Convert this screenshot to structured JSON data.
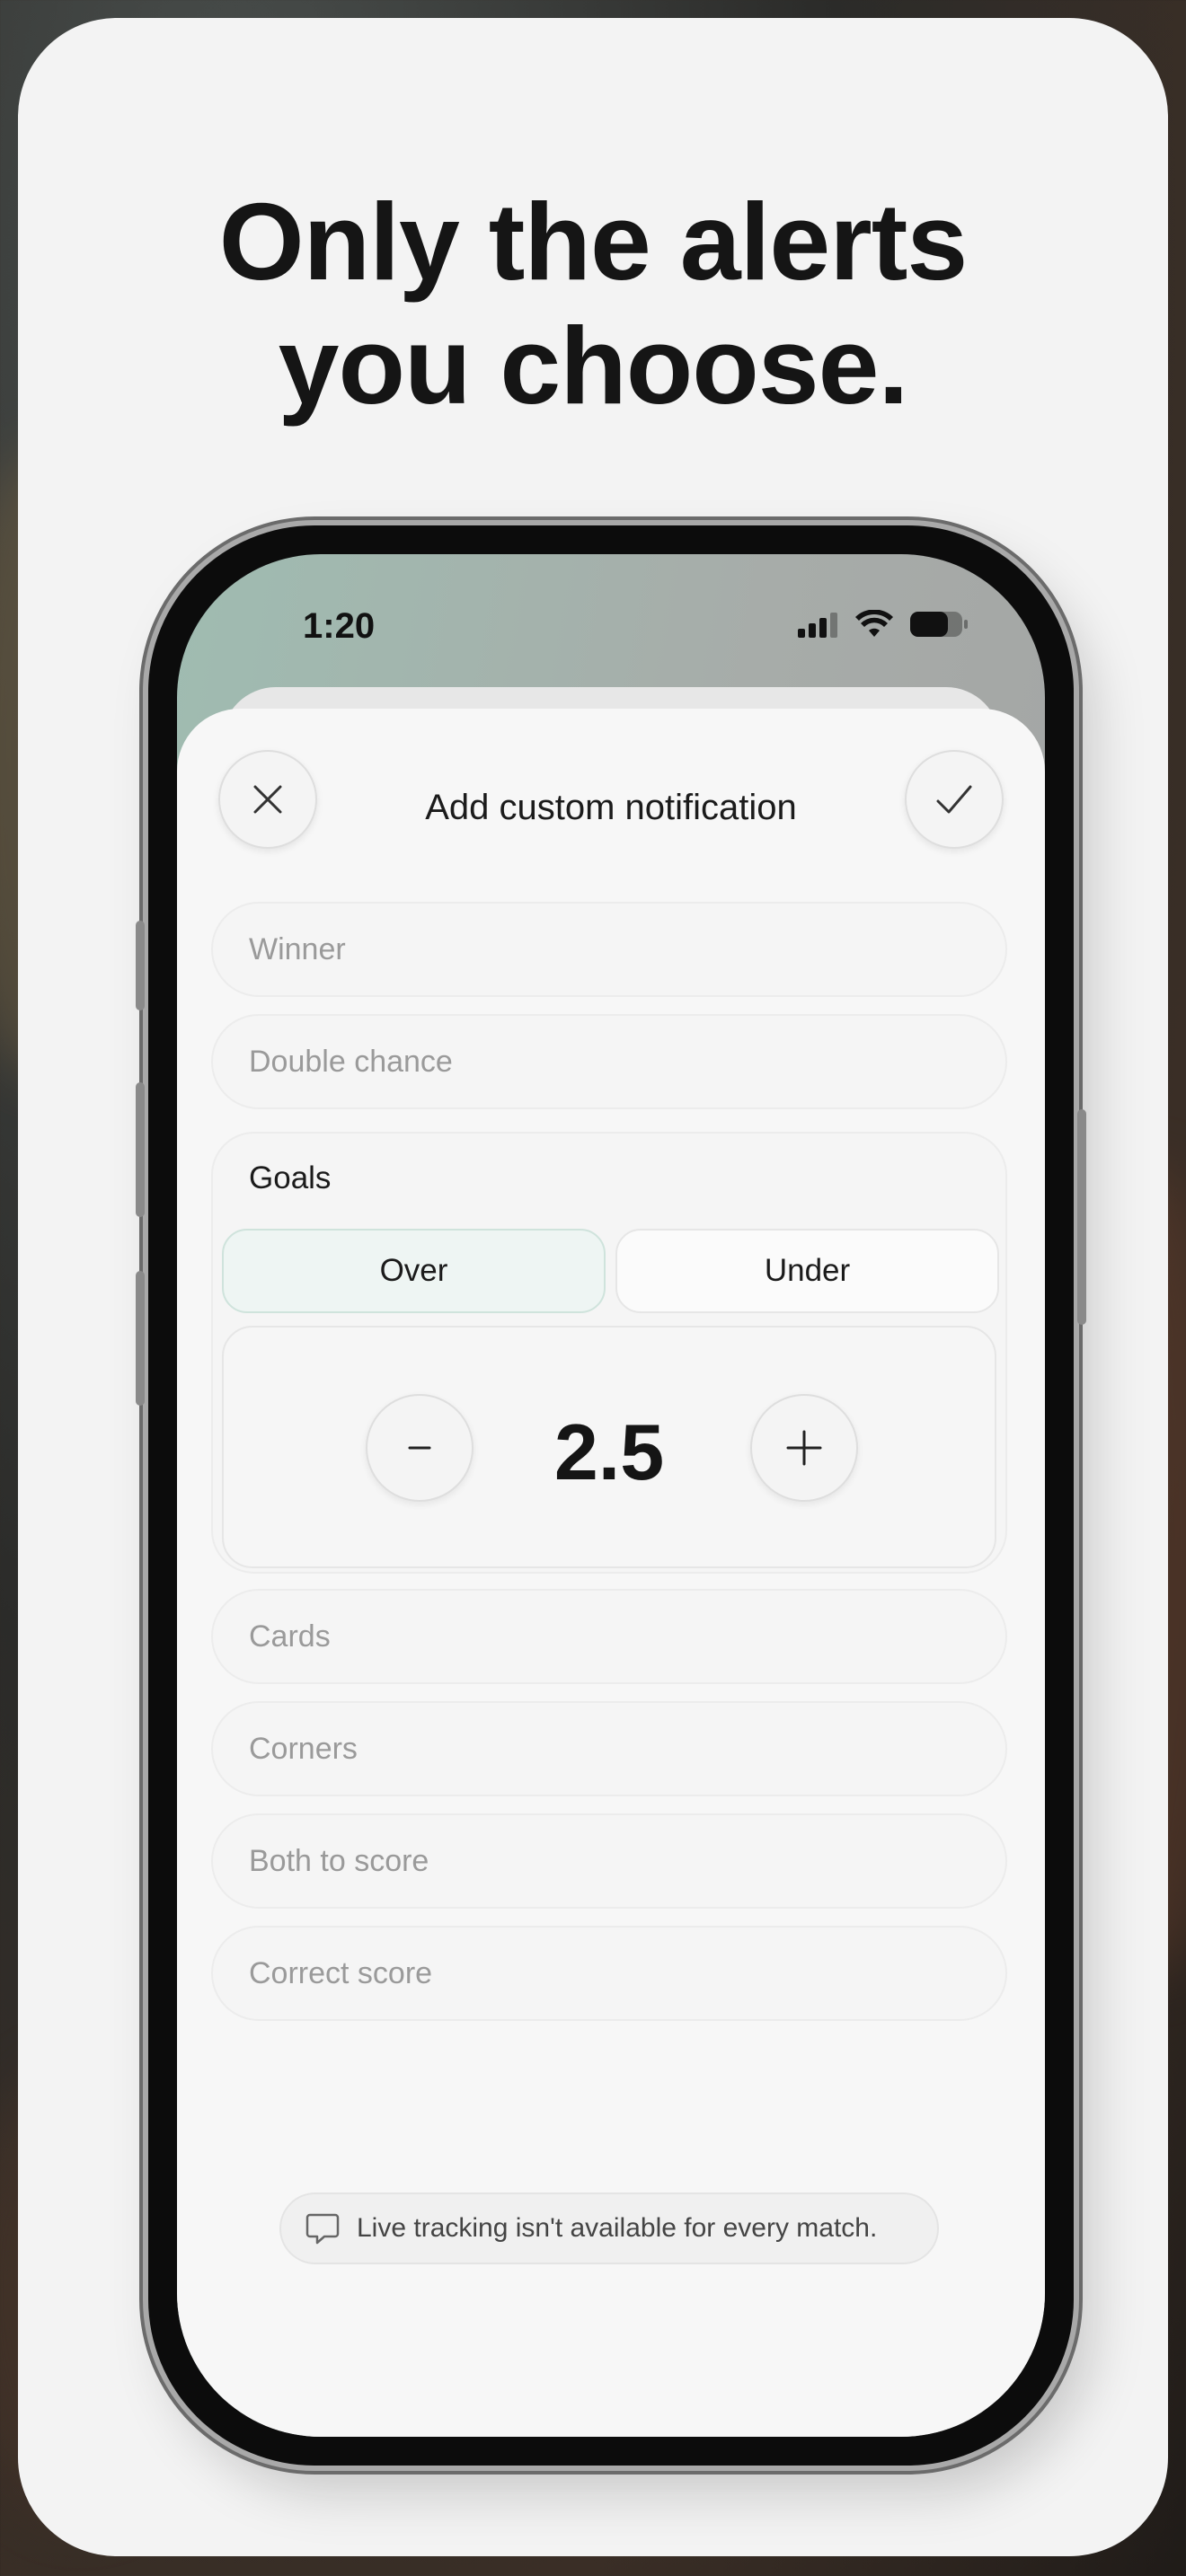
{
  "headline": {
    "line1": "Only the alerts",
    "line2": "you choose."
  },
  "status_bar": {
    "time": "1:20",
    "icons": [
      "cellular-signal-icon",
      "wifi-icon",
      "battery-icon"
    ]
  },
  "sheet": {
    "title": "Add custom notification",
    "close_icon": "close-icon",
    "confirm_icon": "checkmark-icon"
  },
  "markets": {
    "winner": "Winner",
    "double_chance": "Double chance",
    "goals": {
      "label": "Goals",
      "options": {
        "over": "Over",
        "under": "Under"
      },
      "selected": "Over",
      "value": "2.5",
      "decrement_icon": "minus-icon",
      "increment_icon": "plus-icon"
    },
    "cards": "Cards",
    "corners": "Corners",
    "both_to_score": "Both to score",
    "correct_score": "Correct score"
  },
  "notice": {
    "icon": "speech-bubble-icon",
    "text": "Live tracking isn't available for every match."
  },
  "colors": {
    "selected_segment_bg": "#eef5f3",
    "selected_segment_border": "#cfe3dc",
    "card_bg": "#f3f3f3"
  }
}
